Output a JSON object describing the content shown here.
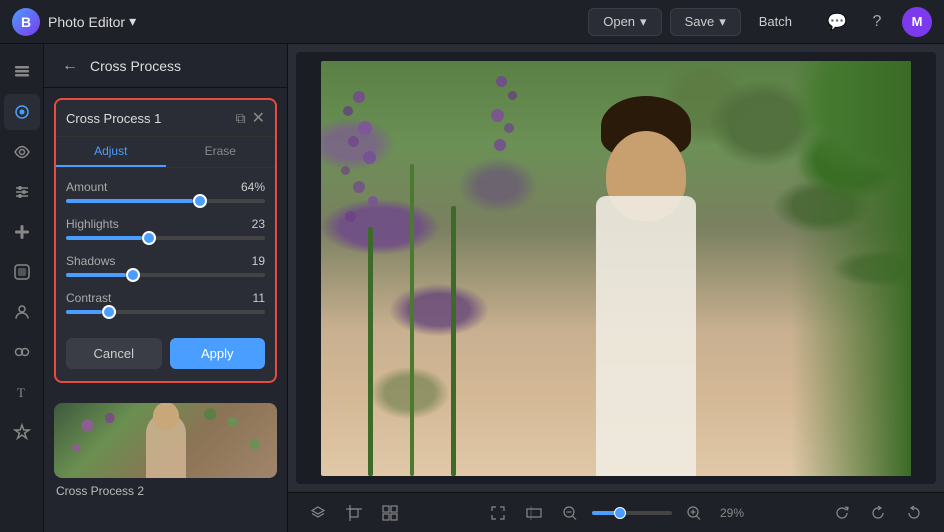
{
  "app": {
    "logo": "B",
    "title": "Photo Editor",
    "title_chevron": "▾"
  },
  "topbar": {
    "open_label": "Open",
    "open_chevron": "▾",
    "save_label": "Save",
    "save_chevron": "▾",
    "batch_label": "Batch"
  },
  "panel": {
    "back_icon": "←",
    "title": "Cross Process",
    "card_title": "Cross Process 1",
    "copy_icon": "⧉",
    "close_icon": "✕",
    "tab_adjust": "Adjust",
    "tab_erase": "Erase",
    "sliders": [
      {
        "label": "Amount",
        "value": 64,
        "percent": 64,
        "unit": "%"
      },
      {
        "label": "Highlights",
        "value": 23,
        "percent": 38,
        "unit": ""
      },
      {
        "label": "Shadows",
        "value": 19,
        "percent": 30,
        "unit": ""
      },
      {
        "label": "Contrast",
        "value": 11,
        "percent": 18,
        "unit": ""
      }
    ],
    "cancel_label": "Cancel",
    "apply_label": "Apply",
    "thumbnail_label": "Cross Process 2"
  },
  "bottom": {
    "zoom_percent": "29%"
  },
  "icons": {
    "layers": "⊞",
    "effects": "✦",
    "eye": "👁",
    "tune": "⚙",
    "brush": "🖌",
    "text": "T",
    "sticker": "★"
  }
}
